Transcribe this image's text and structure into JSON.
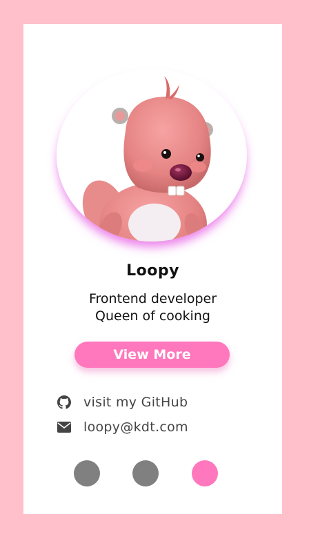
{
  "profile": {
    "name": "Loopy",
    "bio_line1": "Frontend developer",
    "bio_line2": "Queen of cooking",
    "avatar_icon": "beaver-character-avatar"
  },
  "actions": {
    "view_more_label": "View More"
  },
  "contacts": {
    "github_label": "visit my GitHub",
    "github_icon": "github-icon",
    "email_label": "loopy@kdt.com",
    "email_icon": "envelope-icon"
  },
  "pager": {
    "dots": [
      {
        "color": "#808080",
        "active": false
      },
      {
        "color": "#808080",
        "active": false
      },
      {
        "color": "#ff77bd",
        "active": true
      }
    ]
  },
  "colors": {
    "background": "#ffbfcb",
    "card": "#ffffff",
    "accent": "#ff77bd",
    "avatar_glow": "#e96de8"
  }
}
